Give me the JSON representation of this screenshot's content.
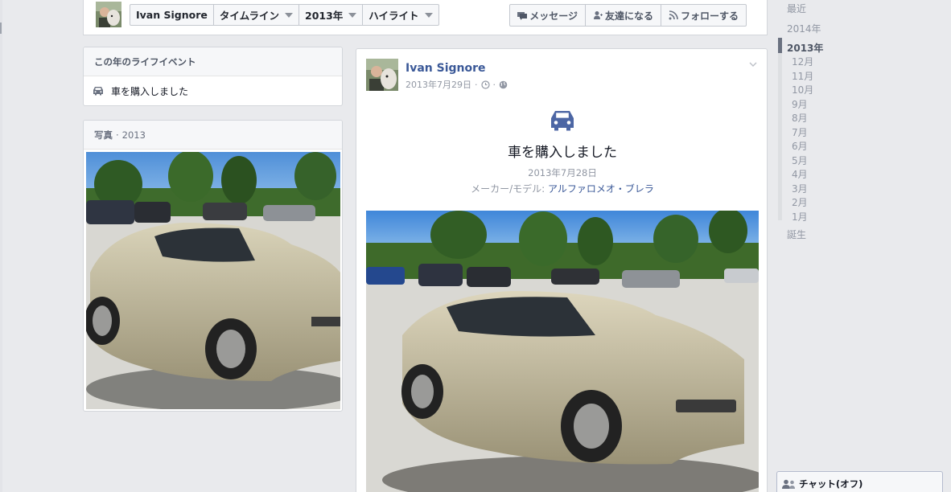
{
  "header": {
    "profile_name": "Ivan Signore",
    "nav": [
      "タイムライン",
      "2013年",
      "ハイライト"
    ],
    "actions": [
      {
        "label": "メッセージ",
        "icon": "message-icon"
      },
      {
        "label": "友達になる",
        "icon": "add-friend-icon"
      },
      {
        "label": "フォローする",
        "icon": "follow-rss-icon"
      }
    ]
  },
  "life_events": {
    "title": "この年のライフイベント",
    "items": [
      {
        "label": "車を購入しました",
        "icon": "car-icon"
      }
    ]
  },
  "photos": {
    "title": "写真",
    "separator": "·",
    "year": "2013"
  },
  "story": {
    "author": "Ivan Signore",
    "date": "2013年7月29日",
    "separator": "·",
    "event_icon": "car-icon",
    "event_title": "車を購入しました",
    "event_date": "2013年7月28日",
    "model_label": "メーカー/モデル:",
    "model_value": "アルファロメオ・ブレラ"
  },
  "scrubber": {
    "recent": "最近",
    "year_2014": "2014年",
    "year_2013": "2013年",
    "months": [
      "12月",
      "11月",
      "10月",
      "9月",
      "8月",
      "7月",
      "6月",
      "5月",
      "4月",
      "3月",
      "2月",
      "1月"
    ],
    "birth": "誕生"
  },
  "chat": {
    "label": "チャット(オフ)"
  },
  "colors": {
    "link_blue": "#3b5998",
    "page_bg": "#e9eaed",
    "event_icon_blue": "#4c66a4"
  }
}
